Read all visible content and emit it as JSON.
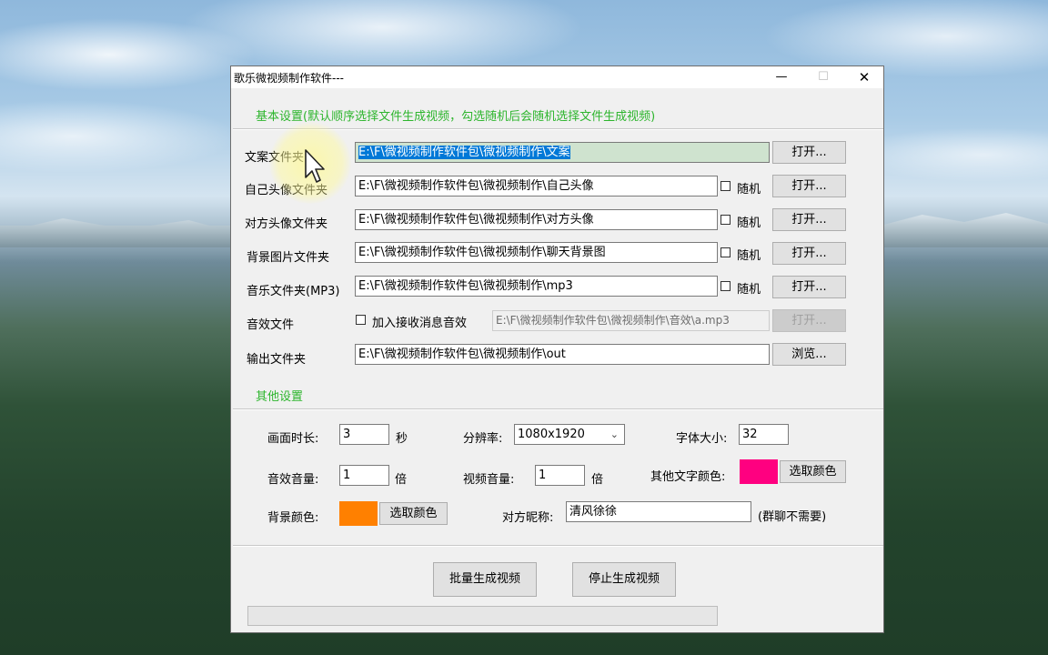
{
  "window": {
    "title": "歌乐微视频制作软件---",
    "controls": {
      "minimize": "—",
      "maximize": "☐",
      "close": "✕"
    }
  },
  "basic": {
    "heading": "基本设置(默认顺序选择文件生成视频，勾选随机后会随机选择文件生成视频)",
    "copy_folder": {
      "label": "文案文件夹",
      "value": "E:\\F\\微视频制作软件包\\微视频制作\\文案",
      "button": "打开..."
    },
    "self_avatar": {
      "label": "自己头像文件夹",
      "value": "E:\\F\\微视频制作软件包\\微视频制作\\自己头像",
      "random": "随机",
      "button": "打开..."
    },
    "peer_avatar": {
      "label": "对方头像文件夹",
      "value": "E:\\F\\微视频制作软件包\\微视频制作\\对方头像",
      "random": "随机",
      "button": "打开..."
    },
    "bg_image": {
      "label": "背景图片文件夹",
      "value": "E:\\F\\微视频制作软件包\\微视频制作\\聊天背景图",
      "random": "随机",
      "button": "打开..."
    },
    "music": {
      "label": "音乐文件夹(MP3)",
      "value": "E:\\F\\微视频制作软件包\\微视频制作\\mp3",
      "random": "随机",
      "button": "打开..."
    },
    "sfx": {
      "label": "音效文件",
      "checkbox": "加入接收消息音效",
      "value": "E:\\F\\微视频制作软件包\\微视频制作\\音效\\a.mp3",
      "button": "打开..."
    },
    "output": {
      "label": "输出文件夹",
      "value": "E:\\F\\微视频制作软件包\\微视频制作\\out",
      "button": "浏览..."
    }
  },
  "other": {
    "heading": "其他设置",
    "duration": {
      "label": "画面时长:",
      "value": "3",
      "unit": "秒"
    },
    "resolution": {
      "label": "分辨率:",
      "value": "1080x1920"
    },
    "font_size": {
      "label": "字体大小:",
      "value": "32"
    },
    "sfx_volume": {
      "label": "音效音量:",
      "value": "1",
      "unit": "倍"
    },
    "video_volume": {
      "label": "视频音量:",
      "value": "1",
      "unit": "倍"
    },
    "text_color": {
      "label": "其他文字颜色:",
      "color": "#ff0080",
      "button": "选取颜色"
    },
    "bg_color": {
      "label": "背景颜色:",
      "color": "#ff8000",
      "button": "选取颜色"
    },
    "nickname": {
      "label": "对方昵称:",
      "value": "清风徐徐",
      "note": "(群聊不需要)"
    }
  },
  "actions": {
    "batch": "批量生成视频",
    "stop": "停止生成视频"
  },
  "progress": {
    "value": 0
  },
  "colors": {
    "section": "#2db52d",
    "selection": "#0078d7"
  }
}
